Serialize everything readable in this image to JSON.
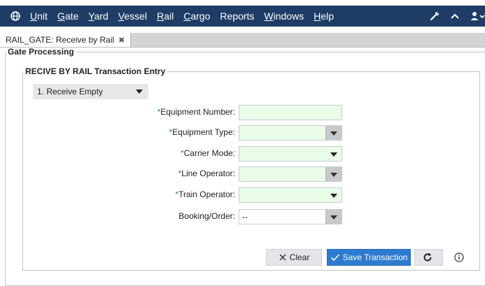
{
  "menubar": {
    "items": [
      "Unit",
      "Gate",
      "Yard",
      "Vessel",
      "Rail",
      "Cargo",
      "Reports",
      "Windows",
      "Help"
    ],
    "underlined": [
      "U",
      "G",
      "Y",
      "V",
      "R",
      "C",
      "",
      "W",
      "H"
    ],
    "rest": [
      "nit",
      "ate",
      "ard",
      "essel",
      "ail",
      "argo",
      "Reports",
      "indows",
      "elp"
    ],
    "bg_color": "#1f3c66"
  },
  "tab": {
    "label": "RAIL_GATE: Receive by Rail",
    "close_glyph": "✖"
  },
  "gate_processing": {
    "legend": "Gate Processing"
  },
  "transaction": {
    "legend": "RECIVE BY RAIL Transaction Entry",
    "type_select": "1. Receive Empty",
    "fields": [
      {
        "label": "Equipment Number:",
        "required": true,
        "value": ""
      },
      {
        "label": "Equipment Type:",
        "required": true,
        "value": ""
      },
      {
        "label": "Carrier Mode:",
        "required": true,
        "value": ""
      },
      {
        "label": "Line Operator:",
        "required": true,
        "value": ""
      },
      {
        "label": "Train Operator:",
        "required": true,
        "value": ""
      },
      {
        "label": "Booking/Order:",
        "required": false,
        "value": "--"
      }
    ],
    "required_mark": "*"
  },
  "buttons": {
    "clear": "Clear",
    "save": "Save Transaction"
  },
  "colors": {
    "accent": "#2d7bd1",
    "required_field_bg": "#e8fce8"
  }
}
